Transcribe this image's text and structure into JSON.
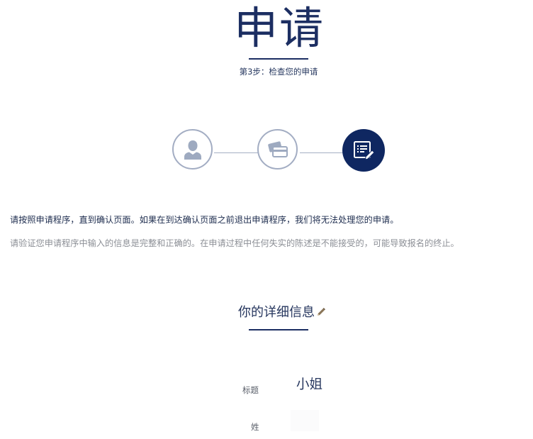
{
  "header": {
    "title": "申请",
    "subtitle": "第3步：检查您的申请"
  },
  "stepper": {
    "current_step": 3,
    "total_steps": 3,
    "steps": [
      {
        "icon": "person-icon",
        "active": false
      },
      {
        "icon": "payment-cards-icon",
        "active": false
      },
      {
        "icon": "document-edit-icon",
        "active": true
      }
    ],
    "colors": {
      "active_fill": "#0f2761",
      "inactive_border": "#a3adc3",
      "inactive_icon": "#9eaac0"
    }
  },
  "instructions": {
    "line1": "请按照申请程序，直到确认页面。如果在到达确认页面之前退出申请程序，我们将无法处理您的申请。",
    "line2": "请验证您申请程序中输入的信息是完整和正确的。在申请过程中任何失实的陈述是不能接受的，可能导致报名的终止。"
  },
  "details": {
    "heading": "你的详细信息",
    "edit_icon": "pencil-icon",
    "fields": [
      {
        "label": "标题",
        "value": "小姐"
      },
      {
        "label": "姓",
        "value": ""
      }
    ]
  },
  "colors": {
    "brand_navy": "#1c2e62",
    "muted_text": "#8c8f96"
  }
}
